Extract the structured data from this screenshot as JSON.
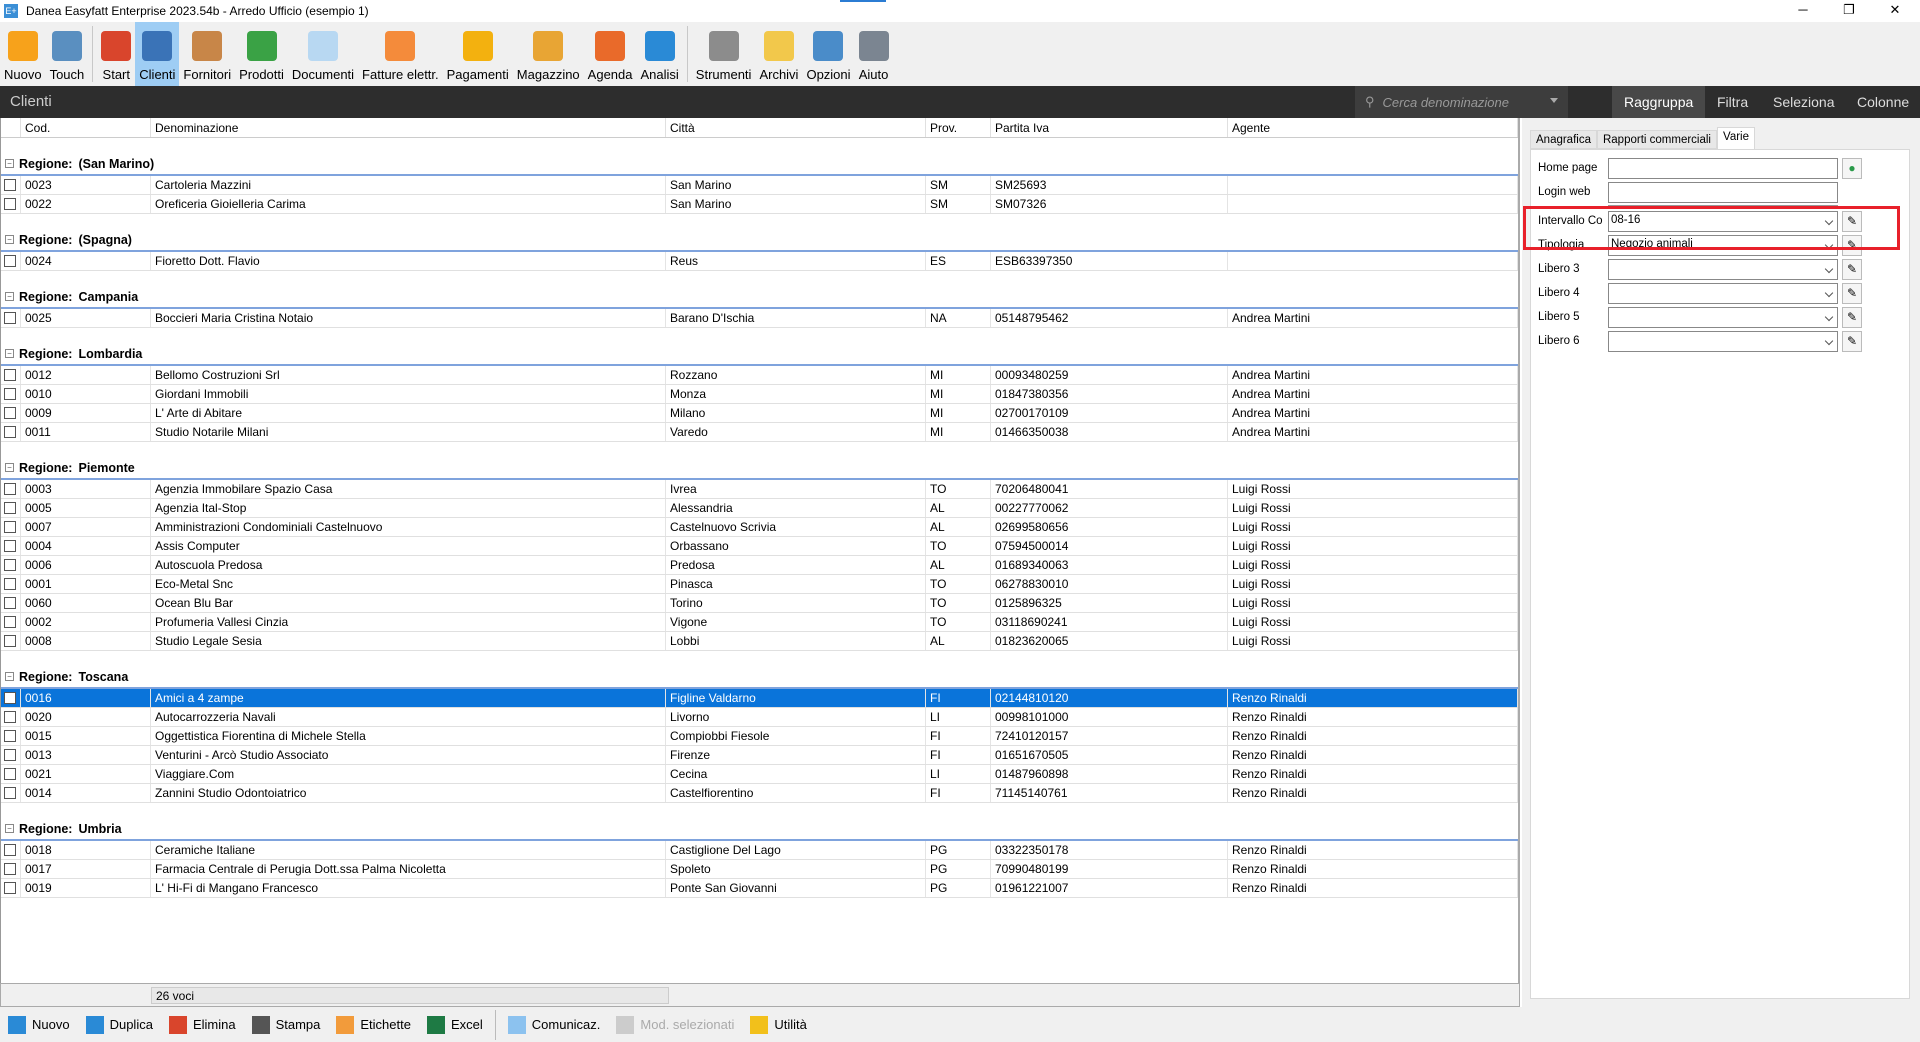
{
  "window": {
    "title": "Danea Easyfatt Enterprise  2023.54b  -  Arredo Ufficio (esempio 1)",
    "app_icon": "E+",
    "minimize": "─",
    "restore": "❐",
    "close": "✕"
  },
  "toolbar": {
    "items": [
      {
        "label": "Nuovo",
        "icon": "new-doc-icon",
        "color": "#f7a21b"
      },
      {
        "label": "Touch",
        "icon": "touch-monitor-icon",
        "color": "#5a8fc0"
      },
      {
        "label": "Start",
        "icon": "home-icon",
        "color": "#d9452c"
      },
      {
        "label": "Clienti",
        "icon": "client-person-icon",
        "color": "#3a73b7",
        "active": true
      },
      {
        "label": "Fornitori",
        "icon": "supplier-person-icon",
        "color": "#c88648"
      },
      {
        "label": "Prodotti",
        "icon": "products-shapes-icon",
        "color": "#3aa245"
      },
      {
        "label": "Documenti",
        "icon": "documents-icon",
        "color": "#b8d8f2"
      },
      {
        "label": "Fatture elettr.",
        "icon": "e-invoice-icon",
        "color": "#f48b3b"
      },
      {
        "label": "Pagamenti",
        "icon": "euro-coin-icon",
        "color": "#f3b10f"
      },
      {
        "label": "Magazzino",
        "icon": "warehouse-trolley-icon",
        "color": "#e8a534"
      },
      {
        "label": "Agenda",
        "icon": "calendar-icon",
        "color": "#e96a2a"
      },
      {
        "label": "Analisi",
        "icon": "analysis-chart-icon",
        "color": "#2a8ad6"
      },
      {
        "label": "Strumenti",
        "icon": "tools-icon",
        "color": "#8c8c8c"
      },
      {
        "label": "Archivi",
        "icon": "archive-folder-icon",
        "color": "#f2c84b"
      },
      {
        "label": "Opzioni",
        "icon": "options-icon",
        "color": "#4a8cc9"
      },
      {
        "label": "Aiuto",
        "icon": "help-icon",
        "color": "#7b8591"
      }
    ]
  },
  "section": {
    "title": "Clienti",
    "search_placeholder": "Cerca denominazione",
    "buttons": [
      "Raggruppa",
      "Filtra",
      "Seleziona",
      "Colonne"
    ],
    "active_button": "Raggruppa"
  },
  "grid": {
    "columns": [
      "Cod.",
      "Denominazione",
      "Città",
      "Prov.",
      "Partita Iva",
      "Agente"
    ],
    "group_prefix": "Regione:",
    "groups": [
      {
        "name": "(San Marino)",
        "rows": [
          [
            "0023",
            "Cartoleria Mazzini",
            "San Marino",
            "SM",
            "SM25693",
            ""
          ],
          [
            "0022",
            "Oreficeria Gioielleria Carima",
            "San Marino",
            "SM",
            "SM07326",
            ""
          ]
        ]
      },
      {
        "name": "(Spagna)",
        "rows": [
          [
            "0024",
            "Fioretto Dott. Flavio",
            "Reus",
            "ES",
            "ESB63397350",
            ""
          ]
        ]
      },
      {
        "name": "Campania",
        "rows": [
          [
            "0025",
            "Boccieri Maria Cristina Notaio",
            "Barano D'Ischia",
            "NA",
            "05148795462",
            "Andrea Martini"
          ]
        ]
      },
      {
        "name": "Lombardia",
        "rows": [
          [
            "0012",
            "Bellomo Costruzioni Srl",
            "Rozzano",
            "MI",
            "00093480259",
            "Andrea Martini"
          ],
          [
            "0010",
            "Giordani Immobili",
            "Monza",
            "MI",
            "01847380356",
            "Andrea Martini"
          ],
          [
            "0009",
            "L' Arte di Abitare",
            "Milano",
            "MI",
            "02700170109",
            "Andrea Martini"
          ],
          [
            "0011",
            "Studio Notarile Milani",
            "Varedo",
            "MI",
            "01466350038",
            "Andrea Martini"
          ]
        ]
      },
      {
        "name": "Piemonte",
        "rows": [
          [
            "0003",
            "Agenzia Immobilare Spazio Casa",
            "Ivrea",
            "TO",
            "70206480041",
            "Luigi Rossi"
          ],
          [
            "0005",
            "Agenzia Ital-Stop",
            "Alessandria",
            "AL",
            "00227770062",
            "Luigi Rossi"
          ],
          [
            "0007",
            "Amministrazioni Condominiali Castelnuovo",
            "Castelnuovo Scrivia",
            "AL",
            "02699580656",
            "Luigi Rossi"
          ],
          [
            "0004",
            "Assis Computer",
            "Orbassano",
            "TO",
            "07594500014",
            "Luigi Rossi"
          ],
          [
            "0006",
            "Autoscuola Predosa",
            "Predosa",
            "AL",
            "01689340063",
            "Luigi Rossi"
          ],
          [
            "0001",
            "Eco-Metal Snc",
            "Pinasca",
            "TO",
            "06278830010",
            "Luigi Rossi"
          ],
          [
            "0060",
            "Ocean Blu Bar",
            "Torino",
            "TO",
            "0125896325",
            "Luigi Rossi"
          ],
          [
            "0002",
            "Profumeria Vallesi Cinzia",
            "Vigone",
            "TO",
            "03118690241",
            "Luigi Rossi"
          ],
          [
            "0008",
            "Studio Legale Sesia",
            "Lobbi",
            "AL",
            "01823620065",
            "Luigi Rossi"
          ]
        ]
      },
      {
        "name": "Toscana",
        "rows": [
          [
            "0016",
            "Amici a 4 zampe",
            "Figline Valdarno",
            "FI",
            "02144810120",
            "Renzo Rinaldi"
          ],
          [
            "0020",
            "Autocarrozzeria Navali",
            "Livorno",
            "LI",
            "00998101000",
            "Renzo Rinaldi"
          ],
          [
            "0015",
            "Oggettistica Fiorentina di Michele Stella",
            "Compiobbi Fiesole",
            "FI",
            "72410120157",
            "Renzo Rinaldi"
          ],
          [
            "0013",
            "Venturini - Arcò Studio Associato",
            "Firenze",
            "FI",
            "01651670505",
            "Renzo Rinaldi"
          ],
          [
            "0021",
            "Viaggiare.Com",
            "Cecina",
            "LI",
            "01487960898",
            "Renzo Rinaldi"
          ],
          [
            "0014",
            "Zannini Studio Odontoiatrico",
            "Castelfiorentino",
            "FI",
            "71145140761",
            "Renzo Rinaldi"
          ]
        ]
      },
      {
        "name": "Umbria",
        "rows": [
          [
            "0018",
            "Ceramiche Italiane",
            "Castiglione Del Lago",
            "PG",
            "03322350178",
            "Renzo Rinaldi"
          ],
          [
            "0017",
            "Farmacia Centrale di Perugia Dott.ssa Palma Nicoletta",
            "Spoleto",
            "PG",
            "70990480199",
            "Renzo Rinaldi"
          ],
          [
            "0019",
            "L' Hi-Fi di Mangano Francesco",
            "Ponte San Giovanni",
            "PG",
            "01961221007",
            "Renzo Rinaldi"
          ]
        ]
      }
    ],
    "selected_code": "0016",
    "count": "26 voci"
  },
  "detail": {
    "tabs": [
      "Anagrafica",
      "Rapporti commerciali",
      "Varie"
    ],
    "active_tab": "Varie",
    "home_page": {
      "label": "Home page",
      "value": ""
    },
    "login_web": {
      "label": "Login web",
      "value": ""
    },
    "combos": [
      {
        "label": "Intervallo Co",
        "value": "08-16",
        "highlighted": true
      },
      {
        "label": "Tipologia",
        "value": "Negozio animali"
      },
      {
        "label": "Libero 3",
        "value": ""
      },
      {
        "label": "Libero 4",
        "value": ""
      },
      {
        "label": "Libero 5",
        "value": ""
      },
      {
        "label": "Libero 6",
        "value": ""
      }
    ]
  },
  "bottom_toolbar": {
    "items": [
      {
        "label": "Nuovo",
        "icon": "new-icon",
        "color": "#2a8ad6"
      },
      {
        "label": "Duplica",
        "icon": "duplicate-icon",
        "color": "#2a8ad6"
      },
      {
        "label": "Elimina",
        "icon": "delete-icon",
        "color": "#d9452c"
      },
      {
        "label": "Stampa",
        "icon": "print-icon",
        "color": "#555"
      },
      {
        "label": "Etichette",
        "icon": "labels-icon",
        "color": "#f29b3b"
      },
      {
        "label": "Excel",
        "icon": "excel-icon",
        "color": "#1e7a44"
      },
      {
        "label": "Comunicaz.",
        "icon": "mail-icon",
        "color": "#8cc2ef"
      },
      {
        "label": "Mod. selezionati",
        "icon": "edit-selected-icon",
        "color": "#ccc",
        "disabled": true
      },
      {
        "label": "Utilità",
        "icon": "lightning-icon",
        "color": "#f2c01b"
      }
    ]
  }
}
